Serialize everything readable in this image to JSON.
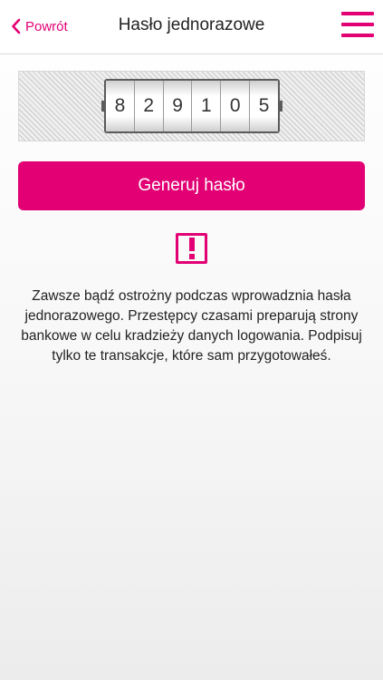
{
  "navbar": {
    "back_label": "Powrót",
    "title": "Hasło jednorazowe",
    "back_icon": "chevron-left-icon",
    "menu_icon": "hamburger-menu-icon"
  },
  "token": {
    "digits": [
      "8",
      "2",
      "9",
      "1",
      "0",
      "5"
    ]
  },
  "actions": {
    "generate_label": "Generuj hasło"
  },
  "warning": {
    "icon": "exclamation-icon",
    "lines": [
      "Zawsze bądź ostrożny podczas wprowadznia hasła",
      "jednorazowego. Przestępcy czasami preparują strony",
      "bankowe w celu kradzieży danych logowania. Podpisuj",
      "tylko te transakcje, które sam przygotowałeś."
    ]
  },
  "colors": {
    "accent": "#e20074",
    "text": "#222222",
    "navbar_bg": "#ffffff"
  }
}
